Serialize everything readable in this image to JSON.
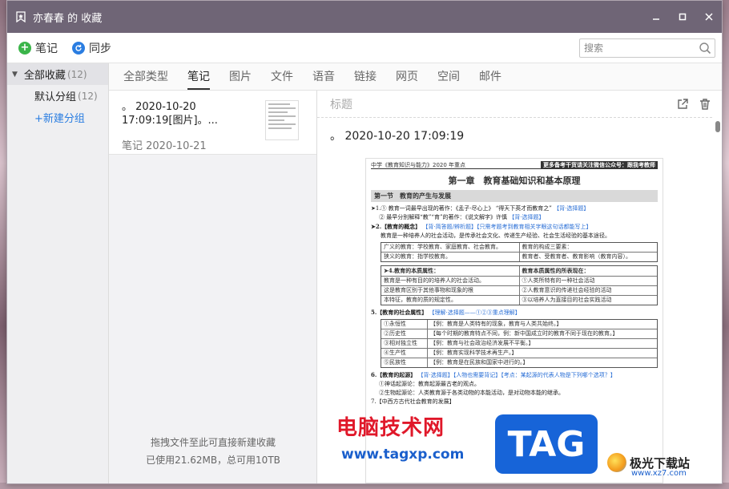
{
  "window": {
    "title": "亦春春 的 收藏"
  },
  "toolbar": {
    "note_label": "笔记",
    "sync_label": "同步",
    "search_placeholder": "搜索"
  },
  "sidebar": {
    "all_label": "全部收藏",
    "all_count": "(12)",
    "default_group_label": "默认分组",
    "default_group_count": "(12)",
    "new_group_label": "+新建分组"
  },
  "tabs": [
    {
      "label": "全部类型"
    },
    {
      "label": "笔记",
      "active": true
    },
    {
      "label": "图片"
    },
    {
      "label": "文件"
    },
    {
      "label": "语音"
    },
    {
      "label": "链接"
    },
    {
      "label": "网页"
    },
    {
      "label": "空间"
    },
    {
      "label": "邮件"
    }
  ],
  "list": {
    "items": [
      {
        "title": "。 2020-10-20 17:09:19[图片]。...",
        "meta": "笔记 2020-10-21"
      }
    ],
    "footer_hint": "拖拽文件至此可直接新建收藏",
    "footer_usage": "已使用21.62MB，总可用10TB"
  },
  "detail": {
    "title_placeholder": "标题",
    "date_line": "。 2020-10-20 17:09:19"
  },
  "doc": {
    "header_left": "中学《教育知识与能力》2020 年重点",
    "header_right": "更多备考干货请关注微信公众号：跟我考教师",
    "chapter": "第一章　教育基础知识和基本原理",
    "section": "第一节　教育的产生与发展",
    "line1": "➤1.① 教育一词最早出现的著作：《孟子·尽心上》 “得天下英才而教育之”",
    "line1_tag": "【背·选择题】",
    "line2": "② 最早分别解释“教”“育”的著作：《说文解字》许慎",
    "line2_tag": "【背·选择题】",
    "line3": "➤2.【教育的概念】",
    "line3_tag": "【背·简答题/辨析题】【只需考题考到教育相关字眼这句话都能写上】",
    "line4": "教育是一种培养人的社会活动，是传承社会文化、传递生产经验、社会生活经验的基本途径。",
    "box1_left": "广义的教育：学校教育、家庭教育、社会教育。",
    "box1_right": "教育的构成三要素：",
    "box1b_left": "狭义的教育：指学校教育。",
    "box1b_right": "教育者、受教育者、教育影响（教育内容）。",
    "line5": "➤4.教育的本质属性：",
    "line5_right": "教育本质属性的所表现在：",
    "row_a": "教育是一种有目的的培养人的社会活动。",
    "row_a_r": "①人类所特有的一种社会活动",
    "row_b": "这是教育区别于其他事物和现象的根",
    "row_b_r": "②人教育意识的传递社会经验的活动",
    "row_c": "本特征，教育的质的规定性。",
    "row_c_r": "③以培养人为直接目的社会实践活动",
    "line6": "5.【教育的社会属性】",
    "line6_tag": "【理解·选择题——①②③重点理解】",
    "attrs": [
      {
        "k": "①永恒性",
        "v": "【例：教育是人类特有的现象，教育与人类共始终。】"
      },
      {
        "k": "②历史性",
        "v": "【每个时期的教育特点不同，例：新中国成立时的教育不同于现在的教育。】"
      },
      {
        "k": "③相对独立性",
        "v": "【例：教育与社会政治经济发展不平衡。】"
      },
      {
        "k": "④生产性",
        "v": "【例：教育实现科学技术再生产。】"
      },
      {
        "k": "⑤民族性",
        "v": "【例：教育是在民族和国家中进行的。】"
      }
    ],
    "line7": "6.【教育的起源】",
    "line7_tag": "【背·选择题】【人物也需要背记】【考点：某起源的代表人物是下列哪个选项？】",
    "line8": "①神话起源论：教育起源最古老的观点。",
    "line9": "②生物起源论：人类教育源于各类动物的本能活动，是对动物本能的继承。",
    "line10": "7.【中西方古代社会教育的发展】"
  },
  "watermark": {
    "site_cn": "电脑技术网",
    "site_url": "www.tagxp.com",
    "tag_text": "TAG",
    "brand_cn": "极光下载站",
    "brand_url": "www.xz7.com"
  }
}
